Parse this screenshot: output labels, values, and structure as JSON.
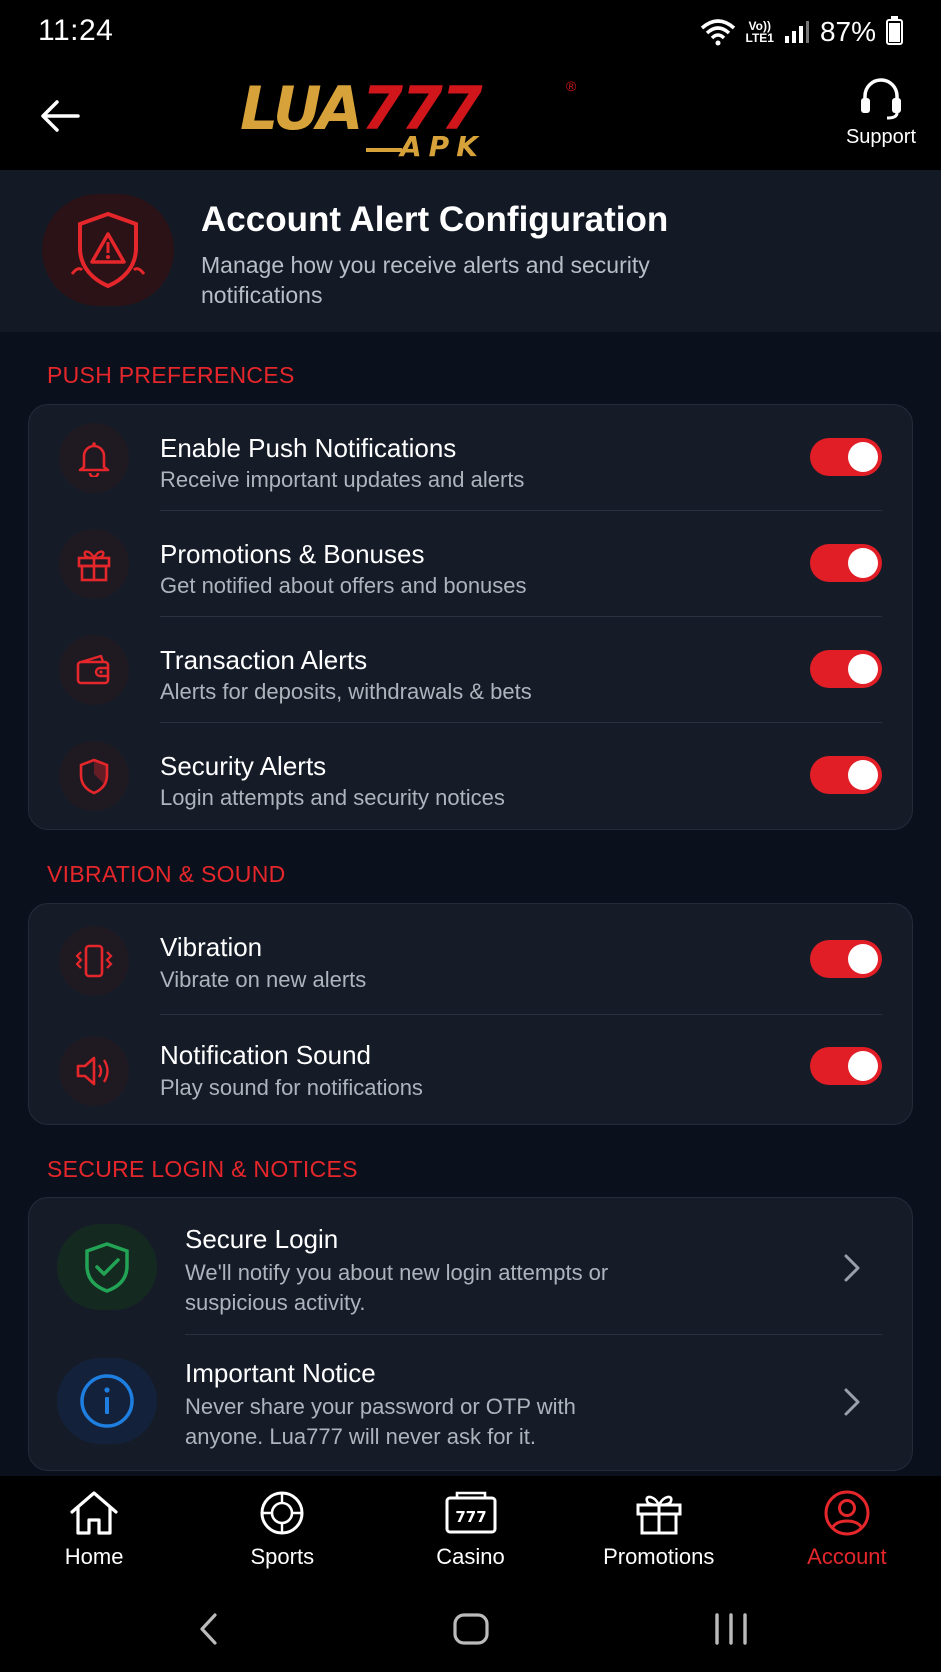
{
  "status_bar": {
    "time": "11:24",
    "network_label_top": "Vo))",
    "network_label_bottom": "LTE1",
    "battery": "87%",
    "battery_level": 0.87
  },
  "header": {
    "logo_main_lua": "LUA",
    "logo_main_777": "777",
    "logo_registered": "®",
    "logo_sub": "APK",
    "support_label": "Support"
  },
  "page": {
    "title": "Account Alert Configuration",
    "subtitle": "Manage how you receive alerts and security notifications"
  },
  "sections": {
    "push": {
      "label": "PUSH PREFERENCES",
      "items": [
        {
          "title": "Enable Push Notifications",
          "desc": "Receive important updates and alerts",
          "icon": "bell-icon",
          "enabled": true
        },
        {
          "title": "Promotions & Bonuses",
          "desc": "Get notified about offers and bonuses",
          "icon": "gift-icon",
          "enabled": true
        },
        {
          "title": "Transaction Alerts",
          "desc": "Alerts for deposits, withdrawals & bets",
          "icon": "wallet-icon",
          "enabled": true
        },
        {
          "title": "Security Alerts",
          "desc": "Login attempts and security notices",
          "icon": "shield-icon",
          "enabled": true
        }
      ]
    },
    "vibration": {
      "label": "VIBRATION & SOUND",
      "items": [
        {
          "title": "Vibration",
          "desc": "Vibrate on new alerts",
          "icon": "vibration-icon",
          "enabled": true
        },
        {
          "title": "Notification Sound",
          "desc": "Play sound for notifications",
          "icon": "speaker-icon",
          "enabled": true
        }
      ]
    },
    "secure": {
      "label": "SECURE LOGIN & NOTICES",
      "items": [
        {
          "title": "Secure Login",
          "desc": "We'll notify you about new login attempts or suspicious activity.",
          "icon": "shield-check-icon"
        },
        {
          "title": "Important Notice",
          "desc": "Never share your password or OTP with anyone. Lua777 will never ask for it.",
          "icon": "info-icon"
        }
      ]
    }
  },
  "bottom_nav": {
    "items": [
      {
        "label": "Home",
        "icon": "home-icon"
      },
      {
        "label": "Sports",
        "icon": "sports-icon"
      },
      {
        "label": "Casino",
        "icon": "casino-icon"
      },
      {
        "label": "Promotions",
        "icon": "gift-icon"
      },
      {
        "label": "Account",
        "icon": "account-icon",
        "active": true
      }
    ]
  },
  "colors": {
    "accent": "#e11d26",
    "background": "#0b111c",
    "card": "#151c28",
    "logo_gold": "#d8a23a",
    "secure_green": "#22a355",
    "info_blue": "#1e7fe0"
  }
}
